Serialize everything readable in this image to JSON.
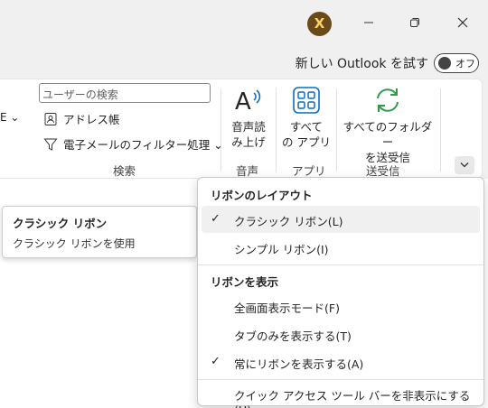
{
  "titlebar": {
    "avatar_letter": "X",
    "minimize_glyph": "minimize-icon",
    "maximize_glyph": "restore-icon",
    "close_glyph": "close-icon"
  },
  "new_outlook": {
    "label": "新しい Outlook を試す",
    "toggle_state": "オフ"
  },
  "ribbon": {
    "cut_label": "E ⌄",
    "search_placeholder": "ユーザーの検索",
    "address_book": "アドレス帳",
    "email_filter": "電子メールのフィルター処理 ⌄",
    "group_search": "検索",
    "read_aloud_line1": "音声読",
    "read_aloud_line2": "み上げ",
    "group_voice": "音声",
    "apps_line1": "すべて",
    "apps_line2": "の アプリ",
    "group_apps": "アプリ",
    "sendrecv_line1": "すべてのフォルダー",
    "sendrecv_line2": "を送受信",
    "group_sendrecv": "送受信"
  },
  "tooltip": {
    "title": "クラシック リボン",
    "description": "クラシック リボンを使用"
  },
  "menu": {
    "section_layout": "リボンのレイアウト",
    "classic": "クラシック リボン(L)",
    "simple": "シンプル リボン(I)",
    "section_show": "リボンを表示",
    "fullscreen": "全画面表示モード(F)",
    "tabs_only": "タブのみを表示する(T)",
    "always_show": "常にリボンを表示する(A)",
    "hide_qat": "クイック アクセス ツール バーを非表示にする (H)",
    "check_glyph": "✓"
  },
  "colors": {
    "accent_blue": "#0f6cbd",
    "accent_green": "#2e9b4a",
    "avatar_bg": "#6b4a1a"
  }
}
